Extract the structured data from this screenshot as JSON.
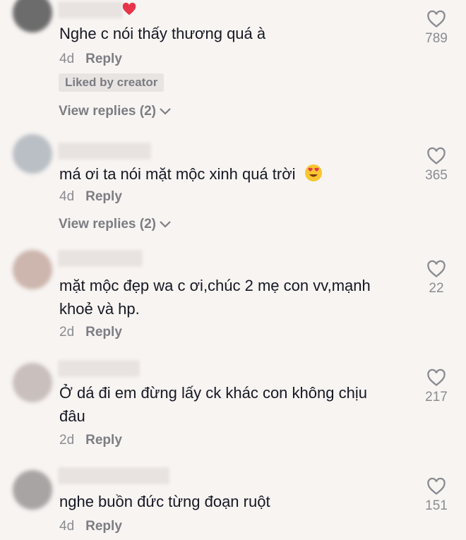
{
  "comments": [
    {
      "text": "Nghe c nói thấy thương quá à",
      "time": "4d",
      "reply_label": "Reply",
      "likes": "789",
      "liked_by_creator": "Liked by creator",
      "view_replies": "View replies (2)"
    },
    {
      "text": "má ơi ta nói mặt mộc xinh quá trời",
      "time": "4d",
      "reply_label": "Reply",
      "likes": "365",
      "view_replies": "View replies (2)"
    },
    {
      "text_line1": "mặt mộc đẹp wa c ơi,chúc 2 mẹ con vv,mạnh",
      "text_line2": "khoẻ và hp.",
      "time": "2d",
      "reply_label": "Reply",
      "likes": "22"
    },
    {
      "text_line1": "Ở dá đi em đừng lấy ck khác con không chịu",
      "text_line2": "đâu",
      "time": "2d",
      "reply_label": "Reply",
      "likes": "217"
    },
    {
      "text": "nghe buồn đức từng đoạn ruột",
      "time": "4d",
      "reply_label": "Reply",
      "likes": "151"
    }
  ],
  "colors": {
    "background": "#f7f4f2",
    "text": "#161823",
    "muted": "#8a8b91",
    "heart_red": "#e8344a"
  }
}
